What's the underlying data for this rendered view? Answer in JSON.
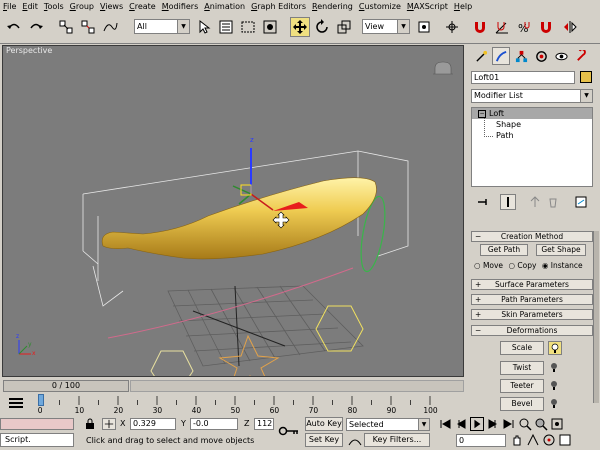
{
  "menu": [
    "File",
    "Edit",
    "Tools",
    "Group",
    "Views",
    "Create",
    "Modifiers",
    "Animation",
    "Graph Editors",
    "Rendering",
    "Customize",
    "MAXScript",
    "Help"
  ],
  "toolbar": {
    "selection_filter": "All",
    "reference_coord": "View"
  },
  "viewport": {
    "label": "Perspective",
    "background": "#7c7c7c",
    "object_color": "#e6c04a"
  },
  "command_panel": {
    "object_name": "Loft01",
    "object_color": "#e6c04a",
    "modifier_list": "Modifier List",
    "stack": [
      "Loft",
      "Shape",
      "Path"
    ],
    "rollouts": {
      "creation_method": "Creation Method",
      "get_path": "Get Path",
      "get_shape": "Get Shape",
      "move": "Move",
      "copy": "Copy",
      "instance": "Instance",
      "surface_parameters": "Surface Parameters",
      "path_parameters": "Path Parameters",
      "skin_parameters": "Skin Parameters",
      "deformations": "Deformations",
      "scale": "Scale",
      "twist": "Twist",
      "teeter": "Teeter",
      "bevel": "Bevel"
    }
  },
  "timeline": {
    "slider": "0 / 100",
    "ticks": [
      "0",
      "10",
      "20",
      "30",
      "40",
      "50",
      "60",
      "70",
      "80",
      "90",
      "100"
    ]
  },
  "status": {
    "script_label": "Script.",
    "prompt": "Click and drag to select and move objects",
    "x_label": "X",
    "x_value": "0.329",
    "y_label": "Y",
    "y_value": "-0.0",
    "z_label": "Z",
    "z_value": "112",
    "auto_key": "Auto Key",
    "set_key": "Set Key",
    "key_filter_value": "Selected",
    "key_filters": "Key Filters...",
    "frame": "0"
  }
}
